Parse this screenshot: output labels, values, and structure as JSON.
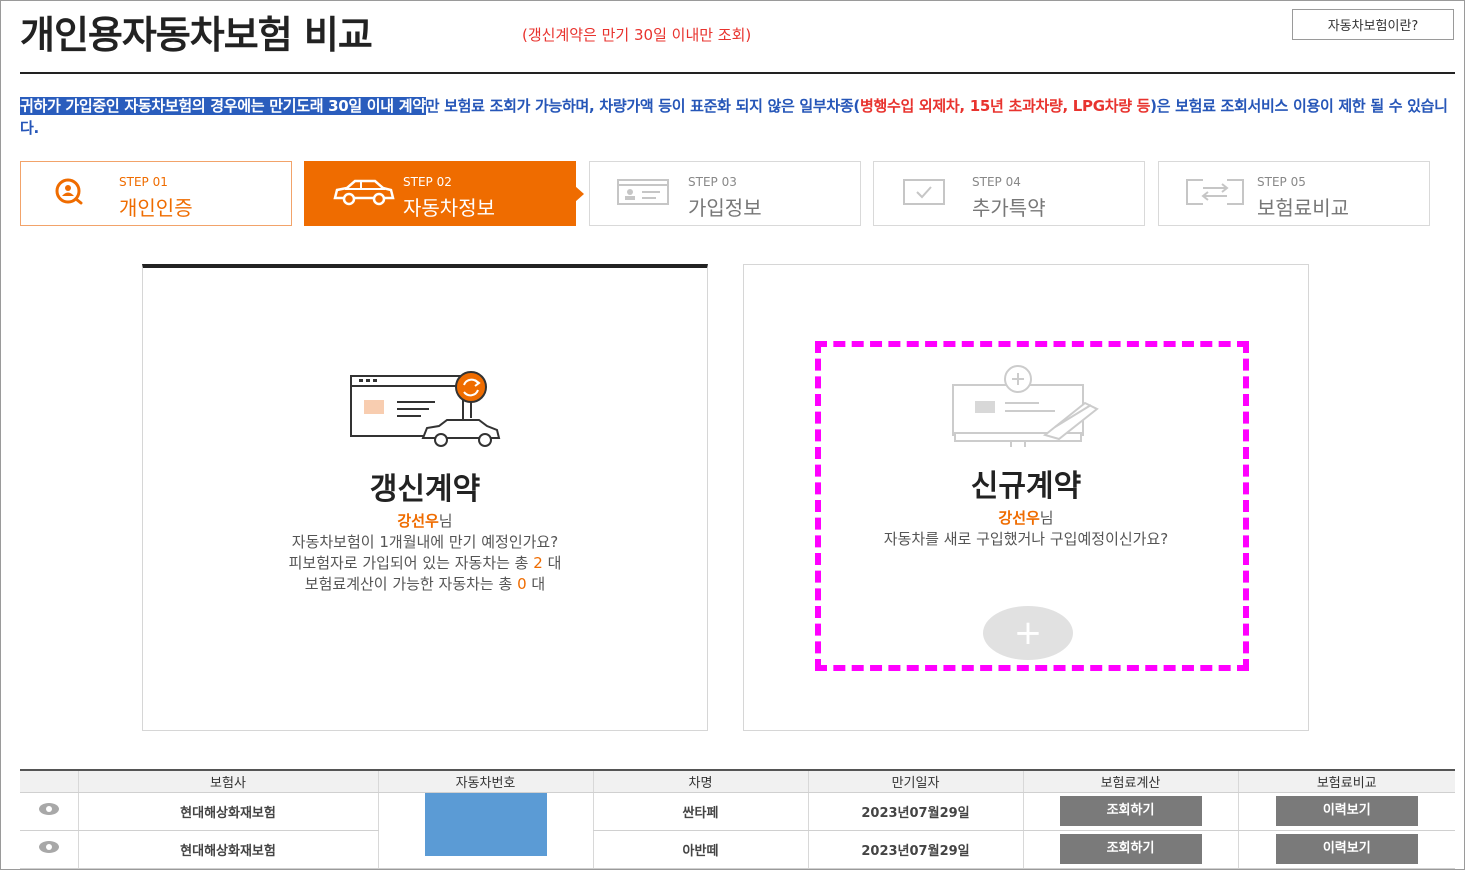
{
  "header": {
    "title": "개인용자동차보험 비교",
    "title_note": "(갱신계약은 만기 30일 이내만 조회)",
    "help_button": "자동차보험이란?"
  },
  "notice": {
    "highlighted": "귀하가 가입중인 자동차보험의 경우에는 만기도래 30일 이내 계약",
    "part1": "만 보험료 조회가 가능하며, 차량가액 등이 표준화 되지 않은 일부차종(",
    "red": "병행수입 외제차, 15년 초과차량, LPG차량 등",
    "part2": ")은 보험료 조회서비스 이용이 제한 될 수 있습니다."
  },
  "steps": [
    {
      "num": "STEP 01",
      "label": "개인인증",
      "icon": "person-search-icon"
    },
    {
      "num": "STEP 02",
      "label": "자동차정보",
      "icon": "car-icon"
    },
    {
      "num": "STEP 03",
      "label": "가입정보",
      "icon": "id-card-icon"
    },
    {
      "num": "STEP 04",
      "label": "추가특약",
      "icon": "checkbox-icon"
    },
    {
      "num": "STEP 05",
      "label": "보험료비교",
      "icon": "compare-arrows-icon"
    }
  ],
  "renew_card": {
    "title": "갱신계약",
    "user_name": "강선우",
    "honorific": "님",
    "line1": "자동차보험이 1개월내에 만기 예정인가요?",
    "line2_pre": "피보험자로 가입되어 있는 자동차는 총 ",
    "line2_count": "2",
    "line2_post": " 대",
    "line3_pre": "보험료계산이 가능한 자동차는 총 ",
    "line3_count": "0",
    "line3_post": " 대"
  },
  "new_card": {
    "title": "신규계약",
    "user_name": "강선우",
    "honorific": "님",
    "line1": "자동차를 새로 구입했거나 구입예정이신가요?",
    "add_symbol": "+"
  },
  "table": {
    "headers": [
      "",
      "보험사",
      "자동차번호",
      "차명",
      "만기일자",
      "보험료계산",
      "보험료비교"
    ],
    "rows": [
      {
        "insurer": "현대해상화재보험",
        "car_name": "싼타페",
        "expiry": "2023년07월29일",
        "calc_label": "조회하기",
        "compare_label": "이력보기"
      },
      {
        "insurer": "현대해상화재보험",
        "car_name": "아반떼",
        "expiry": "2023년07월29일",
        "calc_label": "조회하기",
        "compare_label": "이력보기"
      }
    ]
  },
  "colors": {
    "accent": "#ef6c00",
    "notice_blue": "#2656b8",
    "warning_red": "#e8332e",
    "highlight_magenta": "#ff00ff",
    "plate_blue": "#5b9bd5"
  }
}
